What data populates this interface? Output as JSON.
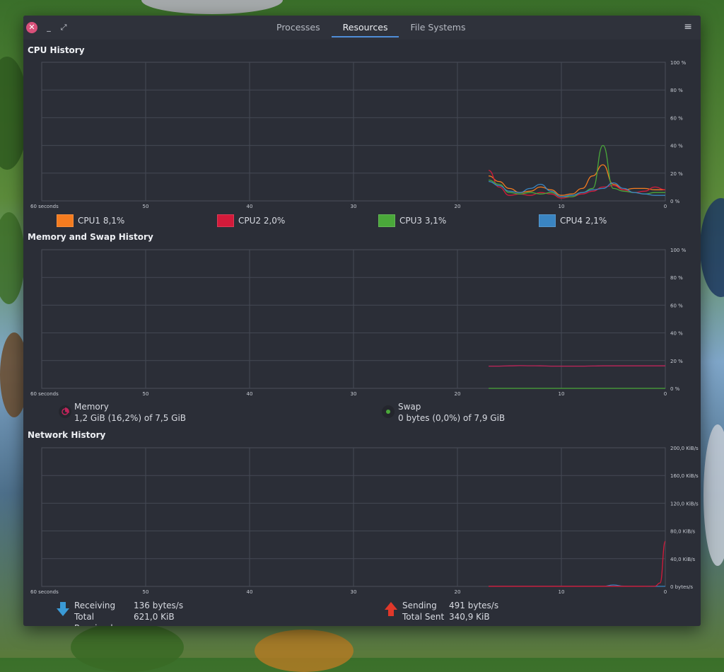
{
  "window": {
    "tabs": [
      {
        "label": "Processes",
        "active": false
      },
      {
        "label": "Resources",
        "active": true
      },
      {
        "label": "File Systems",
        "active": false
      }
    ],
    "close_glyph": "✕",
    "minimize_glyph": "_",
    "maximize_glyph": "⤢",
    "menu_glyph": "≡"
  },
  "cpu": {
    "title": "CPU History",
    "x_ticks": [
      "60 seconds",
      "50",
      "40",
      "30",
      "20",
      "10",
      "0"
    ],
    "y_ticks": [
      "100 %",
      "80 %",
      "60 %",
      "40 %",
      "20 %",
      "0 %"
    ],
    "legend": [
      {
        "label": "CPU1 8,1%",
        "color": "#f57c1f"
      },
      {
        "label": "CPU2 2,0%",
        "color": "#d41a3a"
      },
      {
        "label": "CPU3 3,1%",
        "color": "#4aa83a"
      },
      {
        "label": "CPU4 2,1%",
        "color": "#3a85c2"
      }
    ]
  },
  "memory": {
    "title": "Memory and Swap History",
    "x_ticks": [
      "60 seconds",
      "50",
      "40",
      "30",
      "20",
      "10",
      "0"
    ],
    "y_ticks": [
      "100 %",
      "80 %",
      "60 %",
      "40 %",
      "20 %",
      "0 %"
    ],
    "memory_label": "Memory",
    "memory_value": "1,2 GiB (16,2%) of 7,5 GiB",
    "memory_color": "#c0245a",
    "swap_label": "Swap",
    "swap_value": "0 bytes (0,0%) of 7,9 GiB",
    "swap_color": "#4aa83a"
  },
  "network": {
    "title": "Network History",
    "x_ticks": [
      "60 seconds",
      "50",
      "40",
      "30",
      "20",
      "10",
      "0"
    ],
    "y_ticks": [
      "200,0 KiB/s",
      "160,0 KiB/s",
      "120,0 KiB/s",
      "80,0 KiB/s",
      "40,0 KiB/s",
      "0 bytes/s"
    ],
    "receiving_label": "Receiving",
    "receiving_value": "136 bytes/s",
    "total_received_label": "Total Received",
    "total_received_value": "621,0 KiB",
    "sending_label": "Sending",
    "sending_value": "491 bytes/s",
    "total_sent_label": "Total Sent",
    "total_sent_value": "340,9 KiB",
    "receive_color": "#3a85c2",
    "send_color": "#d41a3a"
  },
  "chart_data": [
    {
      "type": "line",
      "title": "CPU History",
      "xlabel": "",
      "ylabel": "",
      "x": [
        17,
        16,
        15,
        14,
        13,
        12,
        11,
        10,
        9,
        8,
        7,
        6,
        5,
        4,
        3,
        2,
        1,
        0
      ],
      "xlim": [
        60,
        0
      ],
      "ylim": [
        0,
        100
      ],
      "series": [
        {
          "name": "CPU1",
          "values": [
            18,
            14,
            9,
            6,
            7,
            10,
            8,
            4,
            5,
            9,
            18,
            26,
            12,
            8,
            9,
            9,
            8,
            8
          ]
        },
        {
          "name": "CPU2",
          "values": [
            22,
            10,
            4,
            5,
            4,
            6,
            5,
            2,
            3,
            5,
            7,
            10,
            11,
            8,
            6,
            7,
            10,
            8
          ]
        },
        {
          "name": "CPU3",
          "values": [
            15,
            12,
            6,
            5,
            6,
            5,
            6,
            3,
            3,
            6,
            9,
            40,
            9,
            7,
            6,
            5,
            6,
            6
          ]
        },
        {
          "name": "CPU4",
          "values": [
            14,
            11,
            7,
            6,
            9,
            12,
            7,
            3,
            4,
            6,
            8,
            9,
            13,
            9,
            6,
            5,
            4,
            4
          ]
        }
      ]
    },
    {
      "type": "line",
      "title": "Memory and Swap History",
      "xlabel": "",
      "ylabel": "",
      "x": [
        17,
        16,
        15,
        14,
        13,
        12,
        11,
        10,
        9,
        8,
        7,
        6,
        5,
        4,
        3,
        2,
        1,
        0
      ],
      "xlim": [
        60,
        0
      ],
      "ylim": [
        0,
        100
      ],
      "series": [
        {
          "name": "Memory",
          "values": [
            16.0,
            16.0,
            16.2,
            16.4,
            16.3,
            16.2,
            16.0,
            16.0,
            16.0,
            16.0,
            16.1,
            16.2,
            16.2,
            16.2,
            16.2,
            16.2,
            16.2,
            16.2
          ]
        },
        {
          "name": "Swap",
          "values": [
            0,
            0,
            0,
            0,
            0,
            0,
            0,
            0,
            0,
            0,
            0,
            0,
            0,
            0,
            0,
            0,
            0,
            0
          ]
        }
      ]
    },
    {
      "type": "line",
      "title": "Network History",
      "xlabel": "",
      "ylabel": "",
      "x": [
        17,
        16,
        15,
        14,
        13,
        12,
        11,
        10,
        9,
        8,
        7,
        6,
        5,
        4,
        3,
        2,
        1,
        0.5,
        0
      ],
      "xlim": [
        60,
        0
      ],
      "ylim": [
        0,
        200
      ],
      "series": [
        {
          "name": "Receiving",
          "values": [
            0.1,
            0.1,
            0.1,
            0.1,
            0.1,
            0.1,
            0.1,
            0.1,
            0.1,
            0.1,
            0.1,
            0.1,
            2.0,
            0.3,
            0.1,
            0.1,
            0.1,
            0.1,
            0.1
          ]
        },
        {
          "name": "Sending",
          "values": [
            0.2,
            0.2,
            0.2,
            0.2,
            0.2,
            0.2,
            0.2,
            0.2,
            0.2,
            0.2,
            0.2,
            0.2,
            0.2,
            0.2,
            0.2,
            0.2,
            0.3,
            5,
            65
          ]
        }
      ]
    }
  ]
}
